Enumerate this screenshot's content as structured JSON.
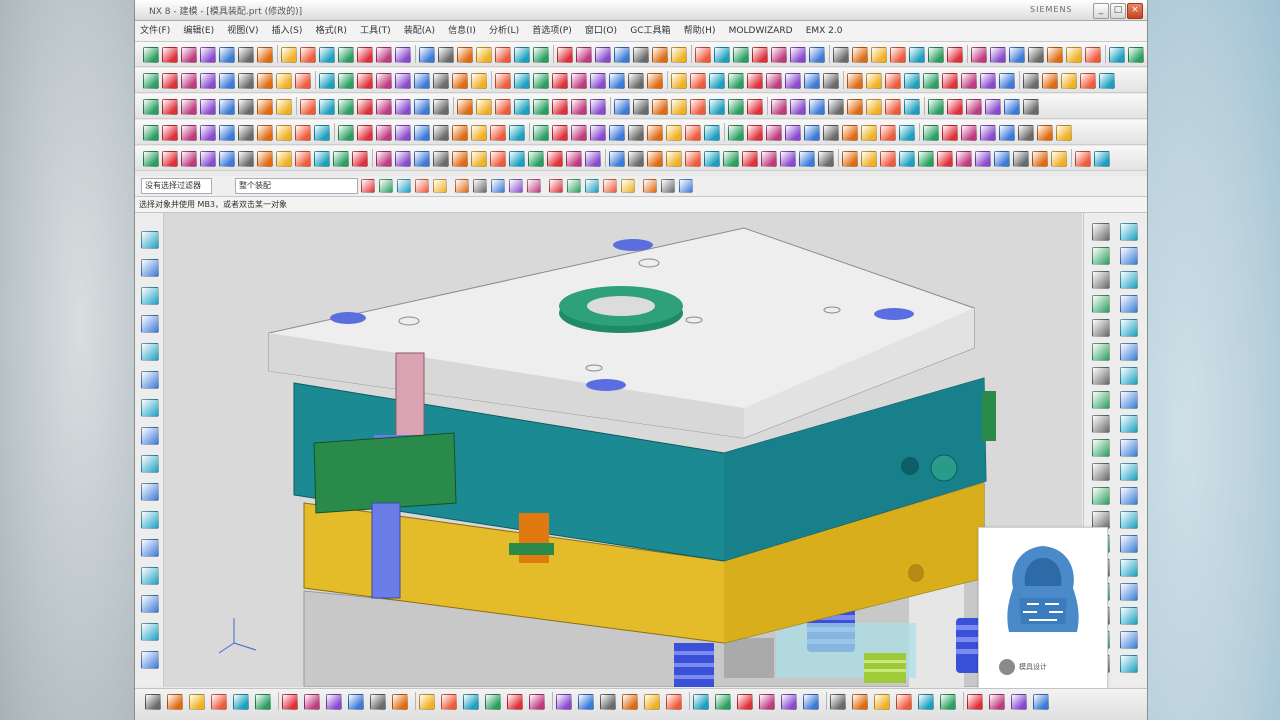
{
  "window": {
    "title": "NX 8 - 建模 - [模具装配.prt (修改的)]",
    "brand": "SIEMENS",
    "minimize_label": "_",
    "maximize_label": "□",
    "close_label": "×"
  },
  "menu": [
    "文件(F)",
    "编辑(E)",
    "视图(V)",
    "插入(S)",
    "格式(R)",
    "工具(T)",
    "装配(A)",
    "信息(I)",
    "分析(L)",
    "首选项(P)",
    "窗口(O)",
    "GC工具箱",
    "帮助(H)",
    "MOLDWIZARD",
    "EMX 2.0"
  ],
  "selection_bar": {
    "filter_value": "没有选择过滤器",
    "scope_value": "整个装配"
  },
  "cue_line": "选择对象并使用 MB3，或者双击某一对象",
  "watermark": {
    "caption": "模具设计"
  },
  "colors": {
    "mold_white": "#eeeeee",
    "mold_teal": "#1c8a93",
    "mold_yellow": "#e4bc2a",
    "sprue_green": "#1f8a66",
    "spring_blue": "#3a50d8",
    "block_green": "#2a8a4a",
    "pink_part": "#d9a3b2"
  }
}
